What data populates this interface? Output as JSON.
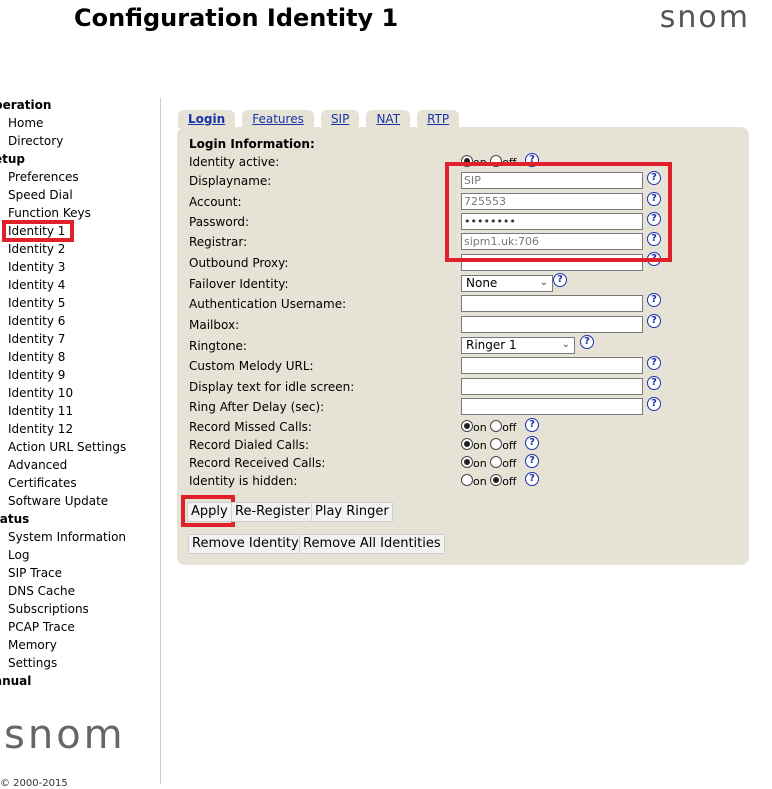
{
  "header": {
    "title": "Configuration Identity 1",
    "logo": "snom"
  },
  "sidebar": {
    "groups": [
      {
        "title": "peration",
        "items": [
          "Home",
          "Directory"
        ]
      },
      {
        "title": "etup",
        "items": [
          "Preferences",
          "Speed Dial",
          "Function Keys",
          "Identity 1",
          "Identity 2",
          "Identity 3",
          "Identity 4",
          "Identity 5",
          "Identity 6",
          "Identity 7",
          "Identity 8",
          "Identity 9",
          "Identity 10",
          "Identity 11",
          "Identity 12",
          "Action URL Settings",
          "Advanced",
          "Certificates",
          "Software Update"
        ]
      },
      {
        "title": "tatus",
        "items": [
          "System Information",
          "Log",
          "SIP Trace",
          "DNS Cache",
          "Subscriptions",
          "PCAP Trace",
          "Memory",
          "Settings"
        ]
      },
      {
        "title": "anual",
        "items": []
      }
    ],
    "selected": "Identity 1",
    "logo": "snom",
    "copyright": "© 2000-2015"
  },
  "tabs": [
    "Login",
    "Features",
    "SIP",
    "NAT",
    "RTP"
  ],
  "active_tab": "Login",
  "form": {
    "section_title": "Login Information:",
    "identity_active": {
      "label": "Identity active:",
      "value": "on"
    },
    "displayname": {
      "label": "Displayname:",
      "value": "SIP"
    },
    "account": {
      "label": "Account:",
      "value": "725553"
    },
    "password": {
      "label": "Password:",
      "value": "••••••••"
    },
    "registrar": {
      "label": "Registrar:",
      "value": "sipm1.uk:706"
    },
    "outbound_proxy": {
      "label": "Outbound Proxy:",
      "value": ""
    },
    "failover_identity": {
      "label": "Failover Identity:",
      "value": "None"
    },
    "auth_username": {
      "label": "Authentication Username:",
      "value": ""
    },
    "mailbox": {
      "label": "Mailbox:",
      "value": ""
    },
    "ringtone": {
      "label": "Ringtone:",
      "value": "Ringer 1"
    },
    "custom_melody_url": {
      "label": "Custom Melody URL:",
      "value": ""
    },
    "display_text_idle": {
      "label": "Display text for idle screen:",
      "value": ""
    },
    "ring_after_delay": {
      "label": "Ring After Delay (sec):",
      "value": ""
    },
    "record_missed": {
      "label": "Record Missed Calls:",
      "value": "on"
    },
    "record_dialed": {
      "label": "Record Dialed Calls:",
      "value": "on"
    },
    "record_received": {
      "label": "Record Received Calls:",
      "value": "on"
    },
    "identity_hidden": {
      "label": "Identity is hidden:",
      "value": "off"
    },
    "radio_on": "on",
    "radio_off": "off",
    "help_glyph": "?"
  },
  "buttons": {
    "apply": "Apply",
    "reregister": "Re-Register",
    "play_ringer": "Play Ringer",
    "remove_identity": "Remove Identity",
    "remove_all": "Remove All Identities"
  },
  "colors": {
    "panel": "#e6e3d6",
    "link": "#1a33a8",
    "highlight": "#e0202a"
  }
}
